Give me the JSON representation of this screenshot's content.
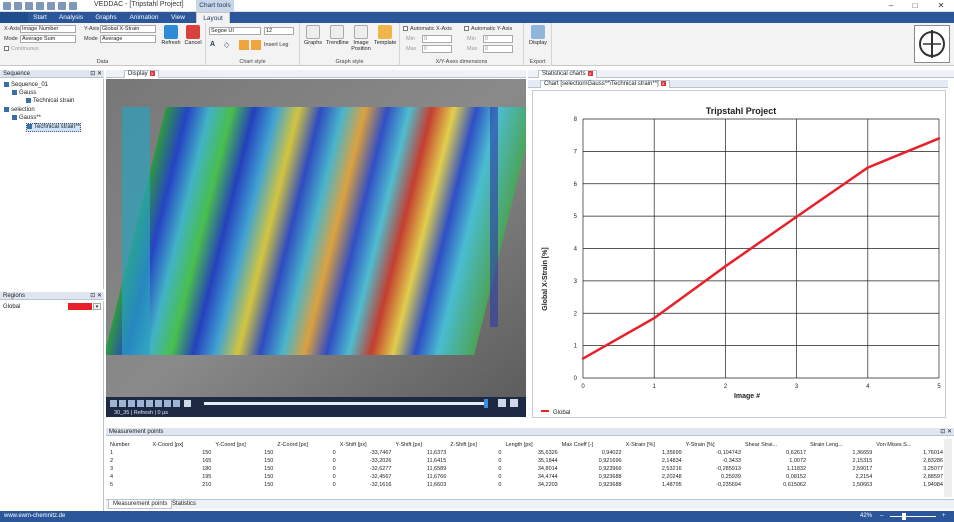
{
  "window": {
    "title": "VEDDAC - [Tripstahl Project]",
    "context_tab": "Chart tools"
  },
  "ribbon_tabs": [
    "Start",
    "Analysis",
    "Graphs",
    "Animation",
    "View",
    "Layout"
  ],
  "ribbon": {
    "data": {
      "xaxis_label": "X-Axis",
      "xaxis_value": "Image Number",
      "mode_label": "Mode",
      "mode_value": "Average Sum",
      "continuous": "Continuous",
      "yaxis_label": "Y-Axis",
      "yaxis_value": "Global X-Strain",
      "ymode_label": "Mode",
      "ymode_value": "Average",
      "refresh": "Refresh",
      "cancel": "Cancel",
      "group": "Data"
    },
    "chart_style": {
      "font": "Segoe UI",
      "size": "12",
      "legend": "Insert Leg",
      "group": "Chart style"
    },
    "graph_style": {
      "graphs": "Graphs",
      "trendline": "Trendline",
      "image_position": "Image Position",
      "template": "Template",
      "group": "Graph style"
    },
    "axes": {
      "auto_x": "Automatic X-Axis",
      "auto_y": "Automatic Y-Axis",
      "min": "Min",
      "max": "Max",
      "zero": "0",
      "group": "X/Y-Axes dimensions"
    },
    "export": {
      "display": "Display",
      "group": "Export"
    }
  },
  "sequence_panel": {
    "title": "Sequence",
    "items": [
      "Sequence_01",
      "Gauss",
      "Technical strain",
      "selection",
      "Gauss**",
      "Technical strain**"
    ]
  },
  "regions_panel": {
    "title": "Regions",
    "region": "Global",
    "region_color": "#e8202a"
  },
  "display_panel": {
    "tab": "Display",
    "frame_info": "30_35 | Refresh | 0 µs"
  },
  "charts_panel": {
    "title": "Statistical charts",
    "tab": "Chart [selection\\Gauss**\\Technical strain**]"
  },
  "chart_data": {
    "type": "line",
    "title": "Tripstahl Project",
    "xlabel": "Image #",
    "ylabel": "Global X-Strain [%]",
    "x": [
      0,
      1,
      2,
      3,
      4,
      5
    ],
    "series": [
      {
        "name": "Global",
        "values": [
          0.6,
          1.85,
          3.45,
          4.98,
          6.5,
          7.4
        ],
        "color": "#e8202a"
      }
    ],
    "xlim": [
      0,
      5
    ],
    "ylim": [
      0,
      8
    ],
    "xticks": [
      "0",
      "1",
      "2",
      "3",
      "4",
      "5"
    ],
    "yticks": [
      "0",
      "1",
      "2",
      "3",
      "4",
      "5",
      "6",
      "7",
      "8"
    ],
    "grid": true,
    "legend": "bottom-left"
  },
  "measurement": {
    "title": "Measurement points",
    "columns": [
      "Number",
      "X-Coord [px]",
      "Y-Coord [px]",
      "Z-Coord [px]",
      "X-Shift [px]",
      "Y-Shift [px]",
      "Z-Shift [px]",
      "Length [px]",
      "Max Coeff [-]",
      "X-Strain [%]",
      "Y-Strain [%]",
      "Shear Strai...",
      "Strain Leng...",
      "Von Mises S..."
    ],
    "rows": [
      [
        "1",
        "150",
        "150",
        "0",
        "-33,7467",
        "11,6373",
        "0",
        "35,6326",
        "0,94022",
        "1,35699",
        "-0,104743",
        "0,62617",
        "1,36659",
        "1,76014"
      ],
      [
        "2",
        "165",
        "150",
        "0",
        "-33,2026",
        "11,6415",
        "0",
        "35,1844",
        "0,921696",
        "2,14834",
        "-0,3433",
        "1,0072",
        "2,15315",
        "2,83286"
      ],
      [
        "3",
        "180",
        "150",
        "0",
        "-32,6277",
        "11,6589",
        "0",
        "34,8014",
        "0,923966",
        "2,53216",
        "-0,285913",
        "1,11832",
        "2,59017",
        "3,25077"
      ],
      [
        "4",
        "195",
        "150",
        "0",
        "-32,4567",
        "11,6766",
        "0",
        "34,4744",
        "0,923688",
        "2,20248",
        "0,25939",
        "0,08152",
        "2,2154",
        "2,88597"
      ],
      [
        "5",
        "210",
        "150",
        "0",
        "-32,1616",
        "11,6603",
        "0",
        "34,2203",
        "0,923688",
        "1,48795",
        "-0,235694",
        "0,615062",
        "1,50663",
        "1,94984"
      ]
    ],
    "tabs": [
      "Measurement points",
      "Statistics"
    ]
  },
  "statusbar": {
    "url": "www.ewm-chemnitz.de",
    "zoom": "42%"
  }
}
